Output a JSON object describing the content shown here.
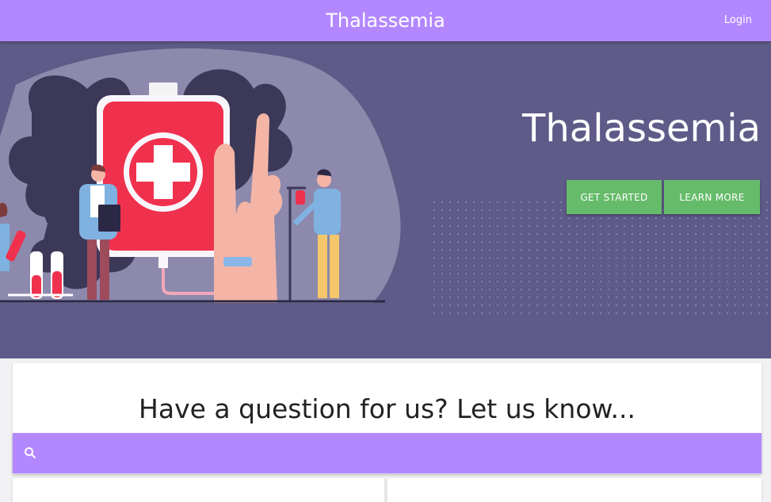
{
  "header": {
    "title": "Thalassemia",
    "login_label": "Login"
  },
  "hero": {
    "title": "Thalassemia",
    "primary_button": "GET STARTED",
    "secondary_button": "LEARN MORE"
  },
  "question": {
    "title": "Have a question for us? Let us know..."
  },
  "search": {
    "icon": "search-icon",
    "value": "",
    "placeholder": ""
  },
  "colors": {
    "header": "#b388ff",
    "hero_background": "#5f5b88",
    "button": "#66bb6a"
  }
}
